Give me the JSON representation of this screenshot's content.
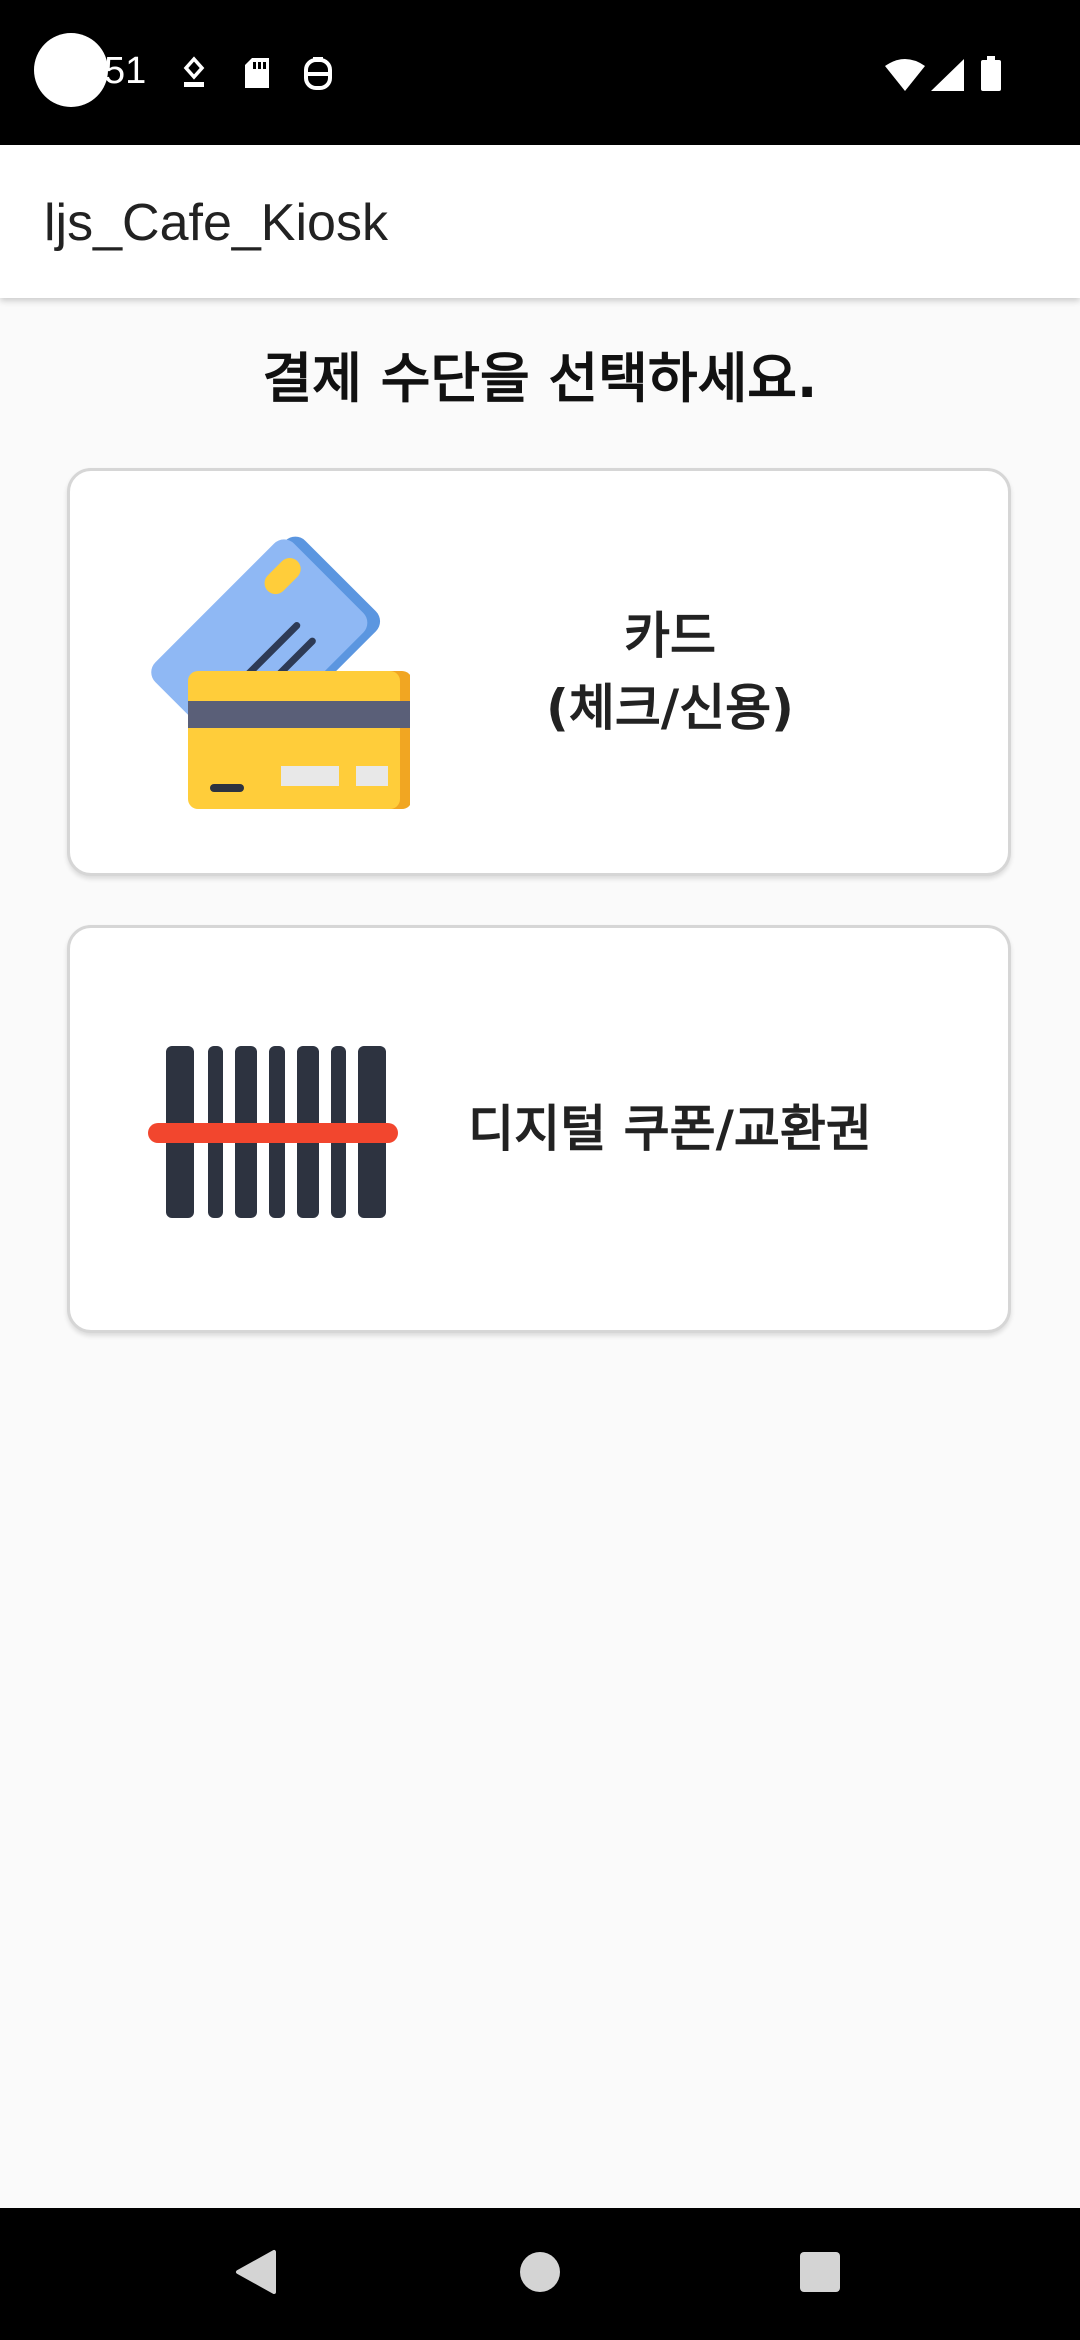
{
  "status_bar": {
    "time": "51"
  },
  "app_bar": {
    "title": "ljs_Cafe_Kiosk"
  },
  "main": {
    "prompt": "결제 수단을 선택하세요.",
    "options": [
      {
        "icon": "credit-card-icon",
        "label_line1": "카드",
        "label_line2": "(체크/신용)"
      },
      {
        "icon": "barcode-icon",
        "label_line1": "디지털 쿠폰/교환권"
      }
    ]
  },
  "colors": {
    "background": "#fafafa",
    "card_border": "#d6d6d6",
    "card_blue": "#8fb8f4",
    "card_yellow": "#ffcd3a",
    "barcode_dark": "#2d3340",
    "scan_red": "#f2462e"
  }
}
